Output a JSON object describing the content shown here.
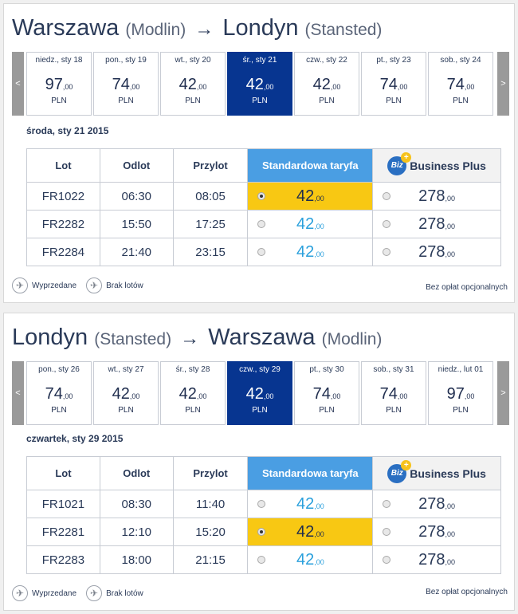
{
  "panels": [
    {
      "route": {
        "from": "Warszawa",
        "from_airport": "(Modlin)",
        "arrow": "→",
        "to": "Londyn",
        "to_airport": "(Stansted)"
      },
      "days": [
        {
          "label": "niedz., sty 18",
          "price": "97",
          "cents": ",00",
          "currency": "PLN"
        },
        {
          "label": "pon., sty 19",
          "price": "74",
          "cents": ",00",
          "currency": "PLN"
        },
        {
          "label": "wt., sty 20",
          "price": "42",
          "cents": ",00",
          "currency": "PLN"
        },
        {
          "label": "śr., sty 21",
          "price": "42",
          "cents": ",00",
          "currency": "PLN",
          "selected": true
        },
        {
          "label": "czw., sty 22",
          "price": "42",
          "cents": ",00",
          "currency": "PLN"
        },
        {
          "label": "pt., sty 23",
          "price": "74",
          "cents": ",00",
          "currency": "PLN"
        },
        {
          "label": "sob., sty 24",
          "price": "74",
          "cents": ",00",
          "currency": "PLN"
        }
      ],
      "date_header": "środa, sty 21 2015",
      "headers": {
        "flight": "Lot",
        "depart": "Odlot",
        "arrive": "Przylot",
        "standard": "Standardowa taryfa",
        "biz_icon": "Biz",
        "business": "Business Plus"
      },
      "flights": [
        {
          "flight": "FR1022",
          "depart": "06:30",
          "arrive": "08:05",
          "std": "42",
          "std_c": ",00",
          "biz": "278",
          "biz_c": ",00",
          "std_selected": true
        },
        {
          "flight": "FR2282",
          "depart": "15:50",
          "arrive": "17:25",
          "std": "42",
          "std_c": ",00",
          "biz": "278",
          "biz_c": ",00"
        },
        {
          "flight": "FR2284",
          "depart": "21:40",
          "arrive": "23:15",
          "std": "42",
          "std_c": ",00",
          "biz": "278",
          "biz_c": ",00"
        }
      ],
      "legend": {
        "soldout": "Wyprzedane",
        "noflights": "Brak lotów"
      },
      "nofee": "Bez opłat opcjonalnych"
    },
    {
      "route": {
        "from": "Londyn",
        "from_airport": "(Stansted)",
        "arrow": "→",
        "to": "Warszawa",
        "to_airport": "(Modlin)"
      },
      "days": [
        {
          "label": "pon., sty 26",
          "price": "74",
          "cents": ",00",
          "currency": "PLN"
        },
        {
          "label": "wt., sty 27",
          "price": "42",
          "cents": ",00",
          "currency": "PLN"
        },
        {
          "label": "śr., sty 28",
          "price": "42",
          "cents": ",00",
          "currency": "PLN"
        },
        {
          "label": "czw., sty 29",
          "price": "42",
          "cents": ",00",
          "currency": "PLN",
          "selected": true
        },
        {
          "label": "pt., sty 30",
          "price": "74",
          "cents": ",00",
          "currency": "PLN"
        },
        {
          "label": "sob., sty 31",
          "price": "74",
          "cents": ",00",
          "currency": "PLN"
        },
        {
          "label": "niedz., lut 01",
          "price": "97",
          "cents": ",00",
          "currency": "PLN"
        }
      ],
      "date_header": "czwartek, sty 29 2015",
      "headers": {
        "flight": "Lot",
        "depart": "Odlot",
        "arrive": "Przylot",
        "standard": "Standardowa taryfa",
        "biz_icon": "Biz",
        "business": "Business Plus"
      },
      "flights": [
        {
          "flight": "FR1021",
          "depart": "08:30",
          "arrive": "11:40",
          "std": "42",
          "std_c": ",00",
          "biz": "278",
          "biz_c": ",00"
        },
        {
          "flight": "FR2281",
          "depart": "12:10",
          "arrive": "15:20",
          "std": "42",
          "std_c": ",00",
          "biz": "278",
          "biz_c": ",00",
          "std_selected": true
        },
        {
          "flight": "FR2283",
          "depart": "18:00",
          "arrive": "21:15",
          "std": "42",
          "std_c": ",00",
          "biz": "278",
          "biz_c": ",00"
        }
      ],
      "legend": {
        "soldout": "Wyprzedane",
        "noflights": "Brak lotów"
      },
      "nofee": "Bez opłat opcjonalnych"
    }
  ],
  "nav": {
    "prev": "<",
    "next": ">"
  },
  "colors": {
    "selected_day": "#073590",
    "standard_header": "#4a9ee3",
    "selected_fare": "#f8c813",
    "std_price": "#2aa0dc",
    "text": "#2a3a58"
  },
  "icons": {
    "soldout": "sold-out-plane-icon",
    "noflights": "no-flights-plane-icon",
    "biz": "biz-plus-badge-icon"
  }
}
